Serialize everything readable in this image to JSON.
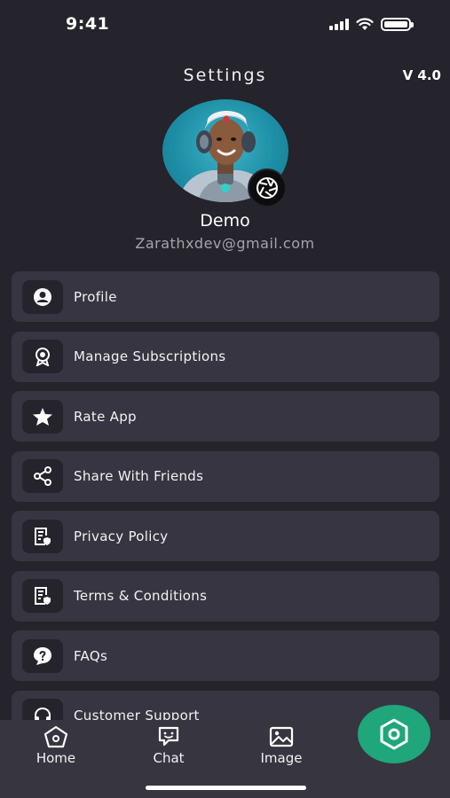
{
  "status": {
    "time": "9:41"
  },
  "header": {
    "title": "Settings",
    "version": "V 4.0"
  },
  "profile": {
    "name": "Demo",
    "email": "Zarathxdev@gmail.com"
  },
  "menu": [
    {
      "label": "Profile",
      "icon": "user-circle-icon"
    },
    {
      "label": "Manage Subscriptions",
      "icon": "award-badge-icon"
    },
    {
      "label": "Rate App",
      "icon": "star-icon"
    },
    {
      "label": "Share With Friends",
      "icon": "share-icon"
    },
    {
      "label": "Privacy Policy",
      "icon": "document-shield-icon"
    },
    {
      "label": "Terms & Conditions",
      "icon": "document-shield-icon"
    },
    {
      "label": "FAQs",
      "icon": "question-bubble-icon"
    },
    {
      "label": "Customer Support",
      "icon": "headset-icon"
    }
  ],
  "nav": {
    "home": "Home",
    "chat": "Chat",
    "image": "Image"
  },
  "colors": {
    "background": "#25232b",
    "card": "#383542",
    "accent": "#1fa67a",
    "avatar_bg": "#1d8ea5"
  }
}
